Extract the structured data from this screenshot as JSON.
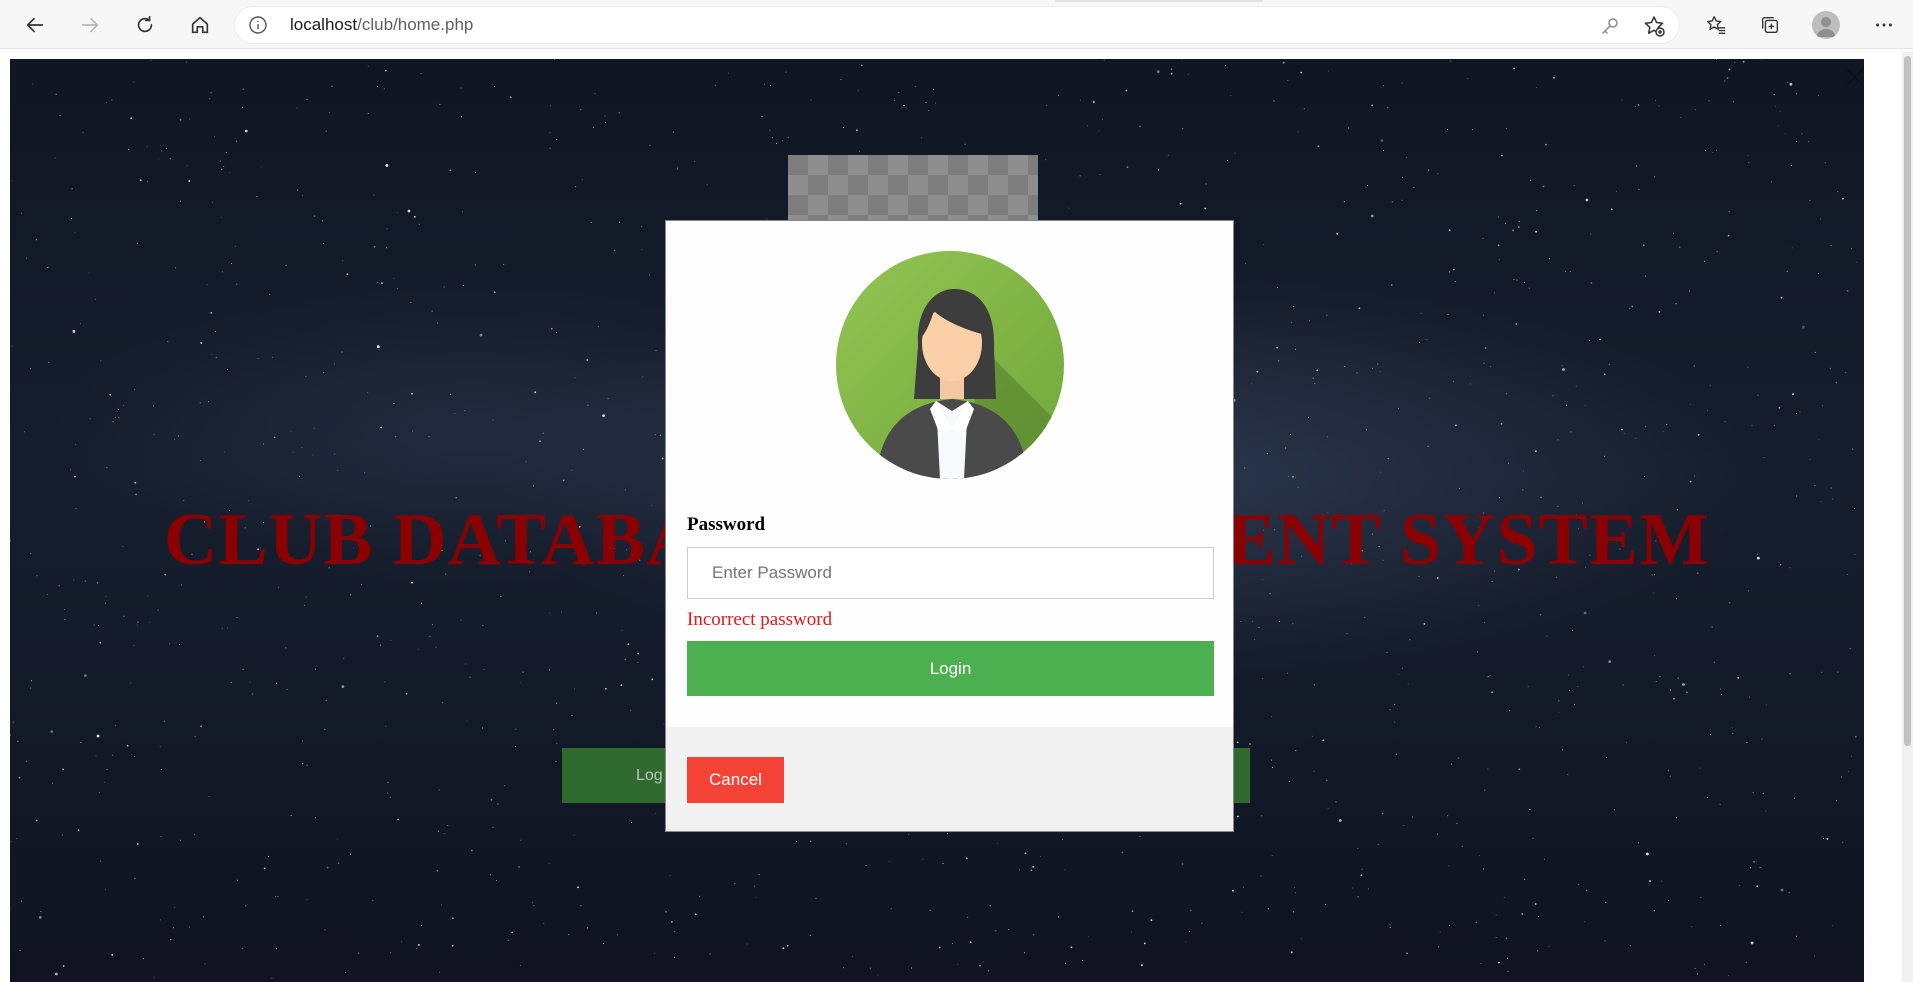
{
  "browser": {
    "url_host": "localhost",
    "url_path": "/club/home.php"
  },
  "page": {
    "hero_title": "CLUB DATABASE MANAGEMENT SYSTEM",
    "hero_left_button_label": "Log",
    "hero_right_button_label": ""
  },
  "modal": {
    "password_label": "Password",
    "password_placeholder": "Enter Password",
    "error_message": "Incorrect password",
    "login_label": "Login",
    "cancel_label": "Cancel"
  },
  "colors": {
    "hero_title": "#8b0000",
    "login_button": "#4caf50",
    "cancel_button": "#f44336",
    "error_text": "#e8151b"
  }
}
